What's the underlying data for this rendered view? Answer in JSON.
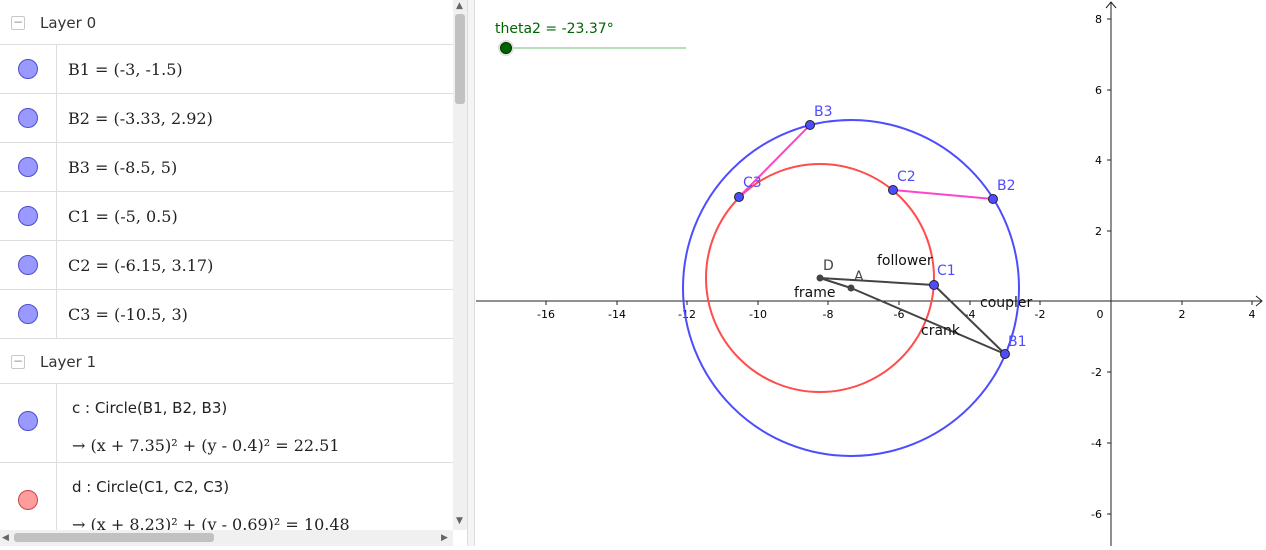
{
  "algebra": {
    "layer0": {
      "label": "Layer 0",
      "toggle": "−"
    },
    "layer0_items": [
      {
        "text": "B1 = (-3, -1.5)"
      },
      {
        "text": "B2 = (-3.33, 2.92)"
      },
      {
        "text": "B3 = (-8.5, 5)"
      },
      {
        "text": "C1 = (-5, 0.5)"
      },
      {
        "text": "C2 = (-6.15, 3.17)"
      },
      {
        "text": "C3 = (-10.5, 3)"
      }
    ],
    "layer1": {
      "label": "Layer 1",
      "toggle": "−"
    },
    "layer1_items": [
      {
        "definition": "c : Circle(B1, B2, B3)",
        "value": "→  (x + 7.35)² + (y - 0.4)² = 22.51",
        "color": "#9999ff"
      },
      {
        "definition": "d : Circle(C1, C2, C3)",
        "value": "→  (x + 8.23)² + (y - 0.69)² = 10.48",
        "color": "#ff9c9c"
      }
    ]
  },
  "slider": {
    "label": "theta2 = -23.37°",
    "value": -23.37,
    "color": "#006400"
  },
  "graph": {
    "x_ticks": [
      "-16",
      "-14",
      "-12",
      "-10",
      "-8",
      "-6",
      "-4",
      "-2",
      "0",
      "2",
      "4"
    ],
    "y_ticks": [
      "8",
      "6",
      "4",
      "2",
      "-2",
      "-4",
      "-6"
    ],
    "point_labels": {
      "B1": "B1",
      "B2": "B2",
      "B3": "B3",
      "C1": "C1",
      "C2": "C2",
      "C3": "C3",
      "A": "A",
      "D": "D"
    },
    "segment_labels": {
      "follower": "follower",
      "frame": "frame",
      "coupler": "coupler",
      "crank": "crank"
    },
    "colors": {
      "circle_c": "#4d4dff",
      "circle_d": "#ff4d4d",
      "link": "#444444",
      "pink": "#ff44cc",
      "point_fill": "#4d4dff",
      "label_blue": "#4d4dff"
    }
  }
}
